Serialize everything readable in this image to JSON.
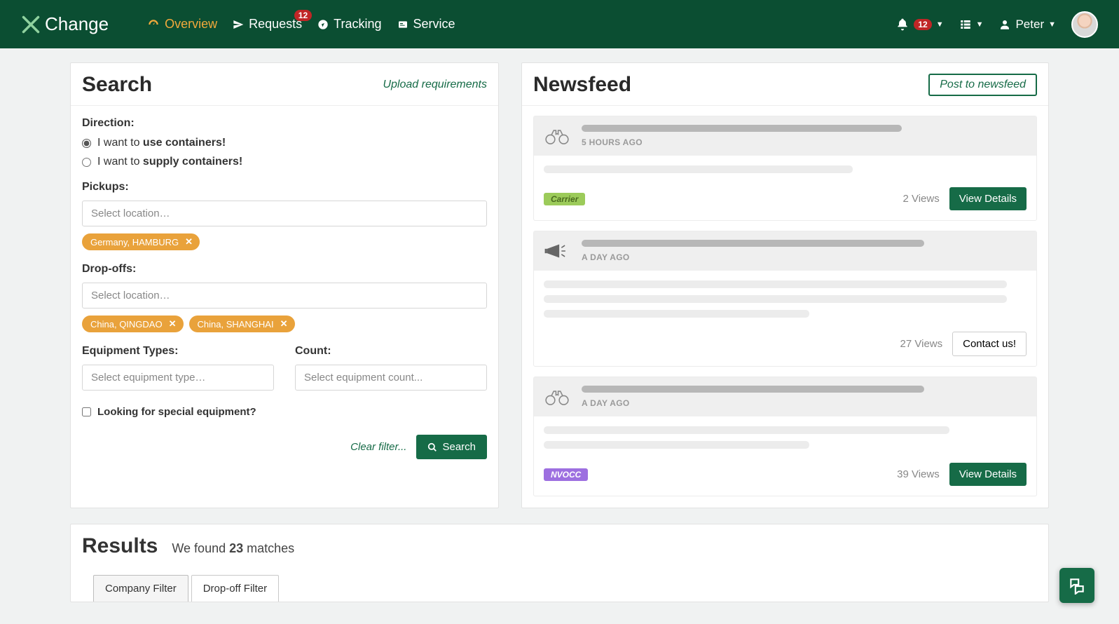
{
  "brand": "Change",
  "nav": {
    "overview": "Overview",
    "requests": "Requests",
    "requests_badge": "12",
    "tracking": "Tracking",
    "service": "Service",
    "notif_count": "12",
    "user_name": "Peter"
  },
  "search": {
    "title": "Search",
    "upload_link": "Upload requirements",
    "direction_label": "Direction:",
    "radio_use_prefix": "I want to ",
    "radio_use_bold": "use containers!",
    "radio_supply_prefix": "I want to ",
    "radio_supply_bold": "supply containers!",
    "pickups_label": "Pickups:",
    "location_placeholder": "Select location…",
    "pickup_tags": [
      "Germany, HAMBURG"
    ],
    "dropoffs_label": "Drop-offs:",
    "dropoff_tags": [
      "China, QINGDAO",
      "China, SHANGHAI"
    ],
    "equip_label": "Equipment Types:",
    "equip_placeholder": "Select equipment type…",
    "count_label": "Count:",
    "count_placeholder": "Select equipment count...",
    "special_check": "Looking for special equipment?",
    "clear_link": "Clear filter...",
    "search_btn": "Search"
  },
  "feed": {
    "title": "Newsfeed",
    "post_btn": "Post to newsfeed",
    "items": [
      {
        "time": "5 HOURS AGO",
        "views": "2 Views",
        "btn": "View Details",
        "btn_style": "green",
        "tag": "Carrier",
        "tag_class": "carrier",
        "lines": 1
      },
      {
        "time": "A DAY AGO",
        "views": "27 Views",
        "btn": "Contact us!",
        "btn_style": "outline",
        "tag": "",
        "tag_class": "",
        "lines": 3
      },
      {
        "time": "A DAY AGO",
        "views": "39 Views",
        "btn": "View Details",
        "btn_style": "green",
        "tag": "NVOCC",
        "tag_class": "nvocc",
        "lines": 2
      }
    ]
  },
  "results": {
    "title": "Results",
    "sub_prefix": "We found ",
    "count": "23",
    "sub_suffix": " matches",
    "tab_company": "Company Filter",
    "tab_dropoff": "Drop-off Filter"
  }
}
